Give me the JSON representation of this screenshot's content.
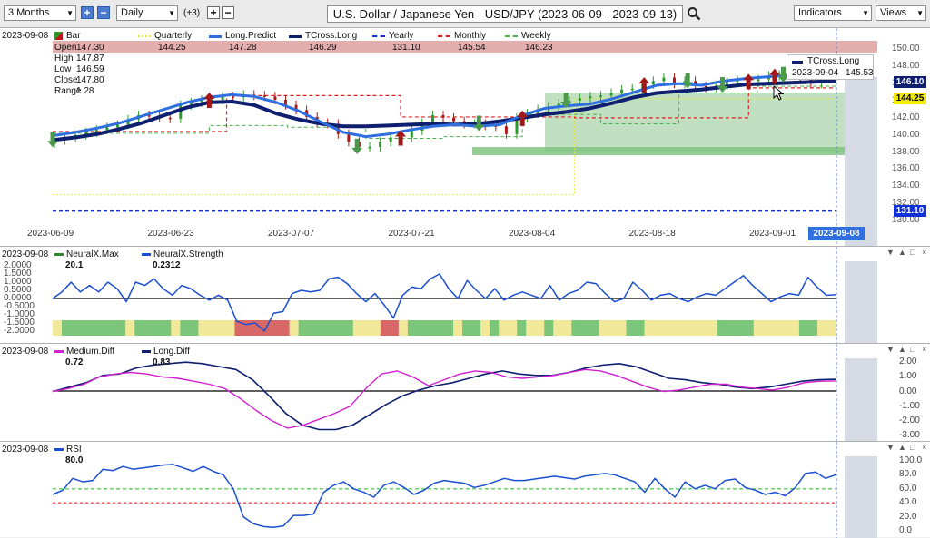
{
  "toolbar": {
    "range_value": "3 Months",
    "interval_value": "Daily",
    "extra_count": "(+3)",
    "title": "U.S. Dollar / Japanese Yen - USD/JPY (2023-06-09 - 2023-09-13)",
    "indicators_label": "Indicators",
    "views_label": "Views"
  },
  "price_panel": {
    "date": "2023-09-08",
    "bar_label": "Bar",
    "ohlc": [
      {
        "label": "Open",
        "value": "147.30"
      },
      {
        "label": "High",
        "value": "147.87"
      },
      {
        "label": "Low",
        "value": "146.59"
      },
      {
        "label": "Close",
        "value": "147.80"
      },
      {
        "label": "Range",
        "value": "1.28"
      }
    ],
    "legend": [
      {
        "name": "Quarterly",
        "value": "144.25",
        "color": "#e8e83a",
        "style": "dotted"
      },
      {
        "name": "Long.Predict",
        "value": "147.28",
        "color": "#2f6fe0",
        "style": "solid"
      },
      {
        "name": "TCross.Long",
        "value": "146.29",
        "color": "#0d1f6e",
        "style": "solid"
      },
      {
        "name": "Yearly",
        "value": "131.10",
        "color": "#1030d8",
        "style": "dashed"
      },
      {
        "name": "Monthly",
        "value": "145.54",
        "color": "#e02020",
        "style": "dashed"
      },
      {
        "name": "Weekly",
        "value": "146.23",
        "color": "#4ab04a",
        "style": "dashed"
      }
    ],
    "tooltip": {
      "name": "TCross.Long",
      "date": "2023-09-04",
      "value": "145.53"
    },
    "axis_ticks": [
      "150.00",
      "148.00",
      "146.00",
      "144.00",
      "142.00",
      "140.00",
      "138.00",
      "136.00",
      "134.00",
      "132.00",
      "130.00"
    ],
    "price_tags": [
      {
        "value": "146.10",
        "bg": "#0d1f6e",
        "fg": "#ffffff"
      },
      {
        "value": "144.25",
        "bg": "#f0e800",
        "fg": "#000000"
      },
      {
        "value": "131.10",
        "bg": "#1030d8",
        "fg": "#ffffff"
      }
    ],
    "x_ticks": [
      "2023-06-09",
      "2023-06-23",
      "2023-07-07",
      "2023-07-21",
      "2023-08-04",
      "2023-08-18",
      "2023-09-01"
    ],
    "cursor_date": "2023-09-08"
  },
  "neural_panel": {
    "date": "2023-09-08",
    "legend": [
      {
        "name": "NeuralX.Max",
        "value": "20.1",
        "color": "#2a8a2a"
      },
      {
        "name": "NeuralX.Strength",
        "value": "0.2312",
        "color": "#1a4fd0"
      }
    ],
    "axis_ticks": [
      "2.0000",
      "1.5000",
      "1.0000",
      "0.5000",
      "0.0000",
      "-0.5000",
      "-1.0000",
      "-1.5000",
      "-2.0000"
    ]
  },
  "diff_panel": {
    "date": "2023-09-08",
    "legend": [
      {
        "name": "Medium.Diff",
        "value": "0.72",
        "color": "#d020d0"
      },
      {
        "name": "Long.Diff",
        "value": "0.83",
        "color": "#0d1f6e"
      }
    ],
    "axis_ticks": [
      "2.00",
      "1.00",
      "0.00",
      "-1.00",
      "-2.00",
      "-3.00"
    ]
  },
  "rsi_panel": {
    "date": "2023-09-08",
    "legend": [
      {
        "name": "RSI",
        "value": "80.0",
        "color": "#1a4fd0"
      }
    ],
    "axis_ticks": [
      "100.0",
      "80.0",
      "60.0",
      "40.0",
      "20.0",
      "0.0"
    ]
  },
  "colors": {
    "bull_arrow": "#4a9a4a",
    "bear_arrow": "#a01818",
    "up_candle": "#2a9a2a",
    "down_candle": "#b01818"
  },
  "chart_data": [
    {
      "type": "candlestick",
      "title": "U.S. Dollar / Japanese Yen - USD/JPY (2023-06-09 - 2023-09-13)",
      "ylim": [
        130,
        151
      ],
      "x_ticks": [
        "2023-06-09",
        "2023-06-23",
        "2023-07-07",
        "2023-07-21",
        "2023-08-04",
        "2023-08-18",
        "2023-09-01"
      ],
      "close": [
        139.4,
        139.7,
        140.0,
        140.3,
        140.6,
        140.9,
        141.2,
        141.8,
        142.3,
        142.2,
        142.0,
        141.9,
        143.5,
        143.8,
        144.1,
        144.1,
        144.5,
        144.4,
        144.7,
        144.6,
        144.5,
        144.1,
        143.5,
        142.9,
        142.1,
        141.4,
        141.3,
        140.1,
        139.2,
        138.6,
        138.6,
        139.2,
        139.7,
        139.7,
        140.5,
        141.4,
        142.3,
        142.0,
        141.6,
        141.3,
        141.3,
        141.1,
        141.0,
        140.1,
        142.0,
        142.5,
        143.0,
        143.3,
        143.7,
        144.0,
        144.3,
        144.5,
        144.6,
        144.9,
        145.3,
        145.4,
        145.9,
        146.3,
        146.7,
        146.0,
        146.3,
        145.7,
        145.5,
        145.8,
        146.2,
        146.4,
        146.3,
        146.5,
        146.9,
        147.0,
        147.2,
        146.5,
        146.0,
        147.0,
        147.8
      ],
      "series": [
        {
          "name": "Long.Predict",
          "values": [
            139.9,
            140.3,
            140.8,
            141.4,
            142.2,
            143.0,
            143.8,
            144.4,
            144.7,
            144.5,
            143.8,
            142.8,
            141.5,
            140.3,
            139.8,
            140.1,
            140.6,
            141.0,
            141.2,
            141.0,
            141.2,
            142.3,
            143.1,
            143.4,
            143.6,
            144.2,
            145.0,
            145.8,
            146.0,
            145.8,
            146.3,
            146.6,
            146.8,
            147.0,
            147.1,
            147.28
          ]
        },
        {
          "name": "TCross.Long",
          "values": [
            139.4,
            139.7,
            140.1,
            140.7,
            141.4,
            142.3,
            143.2,
            143.8,
            143.9,
            143.5,
            142.5,
            141.8,
            141.3,
            141.0,
            141.0,
            141.1,
            141.2,
            141.3,
            141.2,
            141.3,
            141.6,
            142.0,
            142.4,
            142.7,
            143.1,
            143.7,
            144.4,
            144.9,
            145.1,
            145.3,
            145.6,
            145.9,
            146.0,
            146.1,
            146.2,
            146.29
          ]
        },
        {
          "name": "Yearly",
          "values": [
            131.1,
            131.1
          ]
        },
        {
          "name": "Monthly",
          "values": [
            140.4,
            140.4,
            144.6,
            144.6,
            142.1,
            142.1,
            142.0,
            142.0,
            145.5,
            145.5
          ]
        },
        {
          "name": "Weekly",
          "values": [
            140.2,
            140.2,
            141.1,
            140.9,
            139.6,
            139.8,
            142.4,
            141.3,
            144.9,
            145.7,
            146.2
          ]
        },
        {
          "name": "Quarterly",
          "values": [
            133.0,
            133.0,
            144.25,
            144.25
          ]
        }
      ],
      "bull_signals": [
        "2023-06-09",
        "2023-07-14",
        "2023-07-28",
        "2023-08-07",
        "2023-08-21",
        "2023-08-25",
        "2023-09-01"
      ],
      "bear_signals": [
        "2023-06-27",
        "2023-07-19",
        "2023-08-02",
        "2023-08-16",
        "2023-08-28",
        "2023-08-31"
      ]
    },
    {
      "type": "line",
      "name": "NeuralX.Strength",
      "ylim": [
        -2,
        2
      ],
      "values": [
        0.0,
        0.4,
        1.0,
        0.4,
        0.8,
        0.4,
        1.0,
        0.6,
        -0.2,
        1.0,
        0.8,
        1.2,
        0.6,
        0.2,
        0.8,
        0.6,
        0.2,
        -0.1,
        0.2,
        -0.1,
        -1.4,
        -1.6,
        -1.5,
        -2.0,
        -0.9,
        -0.8,
        0.3,
        0.5,
        0.4,
        0.5,
        1.2,
        1.3,
        0.9,
        0.3,
        -0.2,
        0.3,
        -0.4,
        -1.2,
        0.2,
        0.7,
        0.6,
        1.2,
        1.5,
        0.6,
        0.0,
        1.1,
        0.5,
        0.0,
        0.6,
        -0.1,
        0.2,
        0.4,
        0.2,
        0.0,
        0.8,
        -0.1,
        0.3,
        0.5,
        1.0,
        0.9,
        0.3,
        -0.2,
        0.0,
        1.0,
        0.5,
        -0.1,
        0.2,
        0.3,
        0.0,
        -0.2,
        0.1,
        0.3,
        0.2,
        0.6,
        1.0,
        1.4,
        0.8,
        0.3,
        -0.2,
        0.1,
        0.3,
        0.2,
        1.3,
        0.7,
        0.2,
        0.23
      ]
    },
    {
      "type": "line",
      "name": "Diff",
      "ylim": [
        -3,
        2.2
      ],
      "series": [
        {
          "name": "Medium.Diff",
          "values": [
            0.0,
            0.2,
            0.5,
            1.0,
            1.2,
            1.3,
            1.2,
            1.0,
            0.9,
            0.7,
            0.5,
            0.2,
            -0.5,
            -1.3,
            -2.0,
            -2.5,
            -2.3,
            -1.9,
            -1.5,
            -1.0,
            0.2,
            1.2,
            1.4,
            1.0,
            0.4,
            0.8,
            1.2,
            1.4,
            1.3,
            1.0,
            0.9,
            1.0,
            1.1,
            1.3,
            1.5,
            1.4,
            1.1,
            0.7,
            0.3,
            0.0,
            0.1,
            0.3,
            0.5,
            0.5,
            0.3,
            0.2,
            0.1,
            0.3,
            0.6,
            0.7,
            0.72
          ]
        },
        {
          "name": "Long.Diff",
          "values": [
            0.0,
            0.3,
            0.6,
            1.1,
            1.2,
            1.6,
            1.8,
            1.9,
            2.0,
            1.9,
            1.7,
            1.5,
            0.8,
            -0.3,
            -1.5,
            -2.3,
            -2.6,
            -2.6,
            -2.3,
            -1.6,
            -0.9,
            -0.3,
            0.1,
            0.4,
            0.6,
            0.9,
            1.2,
            1.4,
            1.2,
            1.1,
            1.1,
            1.3,
            1.6,
            1.8,
            1.9,
            1.7,
            1.3,
            0.9,
            0.8,
            0.6,
            0.5,
            0.3,
            0.2,
            0.3,
            0.5,
            0.7,
            0.8,
            0.83
          ]
        }
      ]
    },
    {
      "type": "line",
      "name": "RSI",
      "ylim": [
        0,
        100
      ],
      "reference_lines": [
        60,
        40
      ],
      "values": [
        52,
        58,
        75,
        70,
        72,
        88,
        86,
        92,
        88,
        90,
        92,
        94,
        95,
        90,
        85,
        92,
        85,
        80,
        60,
        20,
        10,
        6,
        5,
        7,
        22,
        22,
        24,
        55,
        65,
        70,
        60,
        55,
        48,
        65,
        70,
        62,
        52,
        58,
        68,
        72,
        70,
        68,
        62,
        65,
        70,
        75,
        72,
        72,
        74,
        76,
        78,
        76,
        74,
        78,
        80,
        82,
        80,
        75,
        70,
        55,
        75,
        60,
        48,
        70,
        60,
        65,
        60,
        72,
        74,
        62,
        58,
        52,
        55,
        50,
        62,
        82,
        84,
        75,
        80
      ]
    }
  ]
}
